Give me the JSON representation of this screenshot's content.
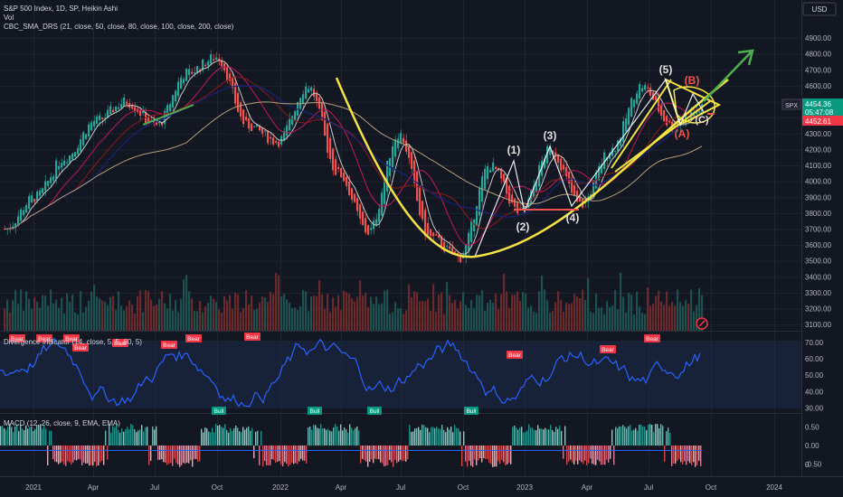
{
  "header": {
    "symbol_line": "S&P 500 Index, 1D, SP, Heikin Ashi",
    "vol_line": "Vol",
    "sma_line": "CBC_SMA_DRS (21, close, 50, close, 80, close, 100, close, 200, close)",
    "currency": "USD"
  },
  "price_badges": {
    "symbol": "SPX",
    "price": "4454.36",
    "countdown": "05:47:08",
    "last": "4452.61"
  },
  "panes": {
    "rsi_title": "Divergence Indicator (14, close, 5, 5, 60, 5)",
    "macd_title": "MACD (12, 26, close, 9, EMA, EMA)"
  },
  "annotations": {
    "wave1": "(1)",
    "wave2": "(2)",
    "wave3": "(3)",
    "wave4": "(4)",
    "wave5": "(5)",
    "waveA": "(A)",
    "waveB": "(B)",
    "waveC": "(C)"
  },
  "signals": {
    "bear": "Bear",
    "bull": "Bull"
  },
  "colors": {
    "background": "#131722",
    "grid": "#1f2430",
    "up": "#26a69a",
    "down": "#ef5350",
    "sma21": "#c8c8c8",
    "sma50": "#c2185b",
    "sma80": "#8e1a1a",
    "sma100": "#1a237e",
    "sma200": "#b39d7a",
    "drawing_yellow": "#f5e342",
    "drawing_green": "#4caf50",
    "rsi_line": "#2962ff",
    "badge_red": "#f23645"
  },
  "chart_data": [
    {
      "type": "candlestick",
      "title": "S&P 500 Index, 1D, SP, Heikin Ashi",
      "x_ticks": [
        "2021",
        "Apr",
        "Jul",
        "Oct",
        "2022",
        "Apr",
        "Jul",
        "Oct",
        "2023",
        "Apr",
        "Jul",
        "Oct",
        "2024"
      ],
      "y_ticks": [
        3100,
        3200,
        3300,
        3400,
        3500,
        3600,
        3700,
        3800,
        3900,
        4000,
        4100,
        4200,
        4300,
        4400,
        4500,
        4600,
        4700,
        4800,
        4900
      ],
      "ylim": [
        3050,
        4980
      ],
      "price_path": [
        {
          "t": "2021-01",
          "v": 3700
        },
        {
          "t": "2021-03",
          "v": 3900
        },
        {
          "t": "2021-05",
          "v": 4150
        },
        {
          "t": "2021-07",
          "v": 4380
        },
        {
          "t": "2021-09",
          "v": 4500
        },
        {
          "t": "2021-10",
          "v": 4350
        },
        {
          "t": "2021-11",
          "v": 4680
        },
        {
          "t": "2022-01",
          "v": 4780
        },
        {
          "t": "2022-02",
          "v": 4350
        },
        {
          "t": "2022-03",
          "v": 4250
        },
        {
          "t": "2022-04",
          "v": 4600
        },
        {
          "t": "2022-05",
          "v": 4050
        },
        {
          "t": "2022-06",
          "v": 3680
        },
        {
          "t": "2022-08",
          "v": 4300
        },
        {
          "t": "2022-09",
          "v": 3650
        },
        {
          "t": "2022-10",
          "v": 3520
        },
        {
          "t": "2022-12",
          "v": 4100
        },
        {
          "t": "2022-12b",
          "v": 3800
        },
        {
          "t": "2023-02",
          "v": 4200
        },
        {
          "t": "2023-03",
          "v": 3850
        },
        {
          "t": "2023-05",
          "v": 4200
        },
        {
          "t": "2023-07",
          "v": 4600
        },
        {
          "t": "2023-08",
          "v": 4350
        },
        {
          "t": "2023-09",
          "v": 4454
        }
      ],
      "moving_averages": [
        "SMA 21",
        "SMA 50",
        "SMA 80",
        "SMA 100",
        "SMA 200"
      ]
    },
    {
      "type": "line",
      "title": "Divergence Indicator (14, close, 5, 5, 60, 5)",
      "y_ticks": [
        30,
        40,
        50,
        60,
        70
      ],
      "ylim": [
        28,
        75
      ]
    },
    {
      "type": "bar",
      "title": "MACD (12, 26, close, 9, EMA, EMA)",
      "y_ticks": [
        -0.5,
        0,
        0.5
      ],
      "extra_tick": "0",
      "ylim": [
        -0.75,
        0.75
      ]
    }
  ]
}
